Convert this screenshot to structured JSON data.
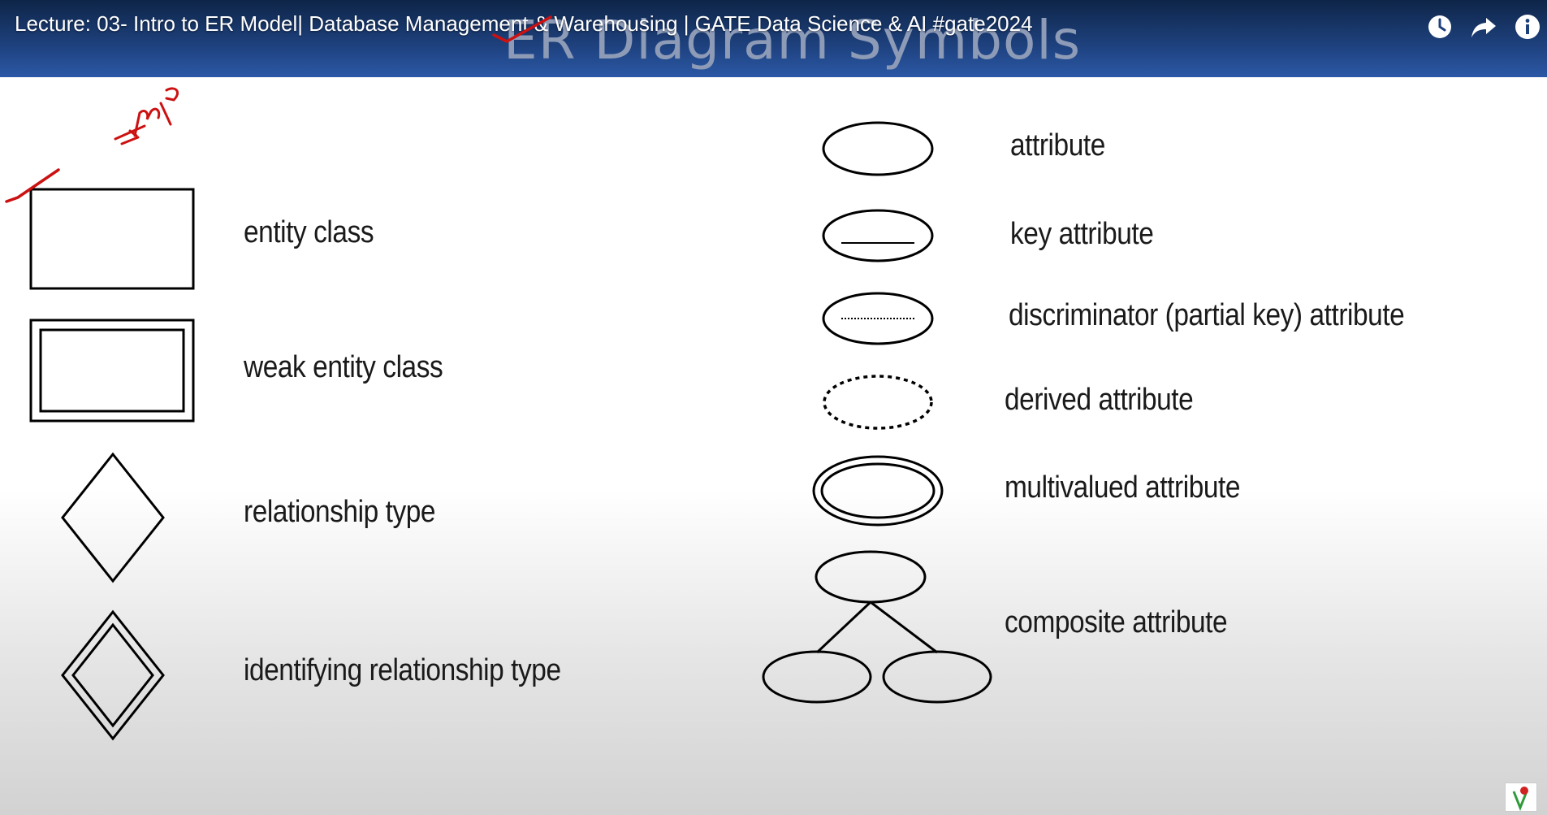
{
  "video": {
    "title": "Lecture: 03- Intro to ER Model| Database Management & Warehousing | GATE Data Science & AI #gate2024"
  },
  "controls": {
    "watch_later_icon": "clock-icon",
    "share_icon": "share-arrow-icon",
    "info_icon": "info-icon"
  },
  "slide": {
    "heading": "ER Diagram Symbols",
    "header_color": "#1d3f7a",
    "annotation_color": "#cc1111",
    "annotation_text": "Imp",
    "left_symbols": [
      {
        "label": "entity class"
      },
      {
        "label": "weak entity class"
      },
      {
        "label": "relationship type"
      },
      {
        "label": "identifying relationship type"
      }
    ],
    "right_symbols": [
      {
        "label": "attribute"
      },
      {
        "label": "key attribute"
      },
      {
        "label": "discriminator (partial key) attribute"
      },
      {
        "label": "derived attribute"
      },
      {
        "label": "multivalued attribute"
      },
      {
        "label": "composite attribute"
      }
    ]
  }
}
